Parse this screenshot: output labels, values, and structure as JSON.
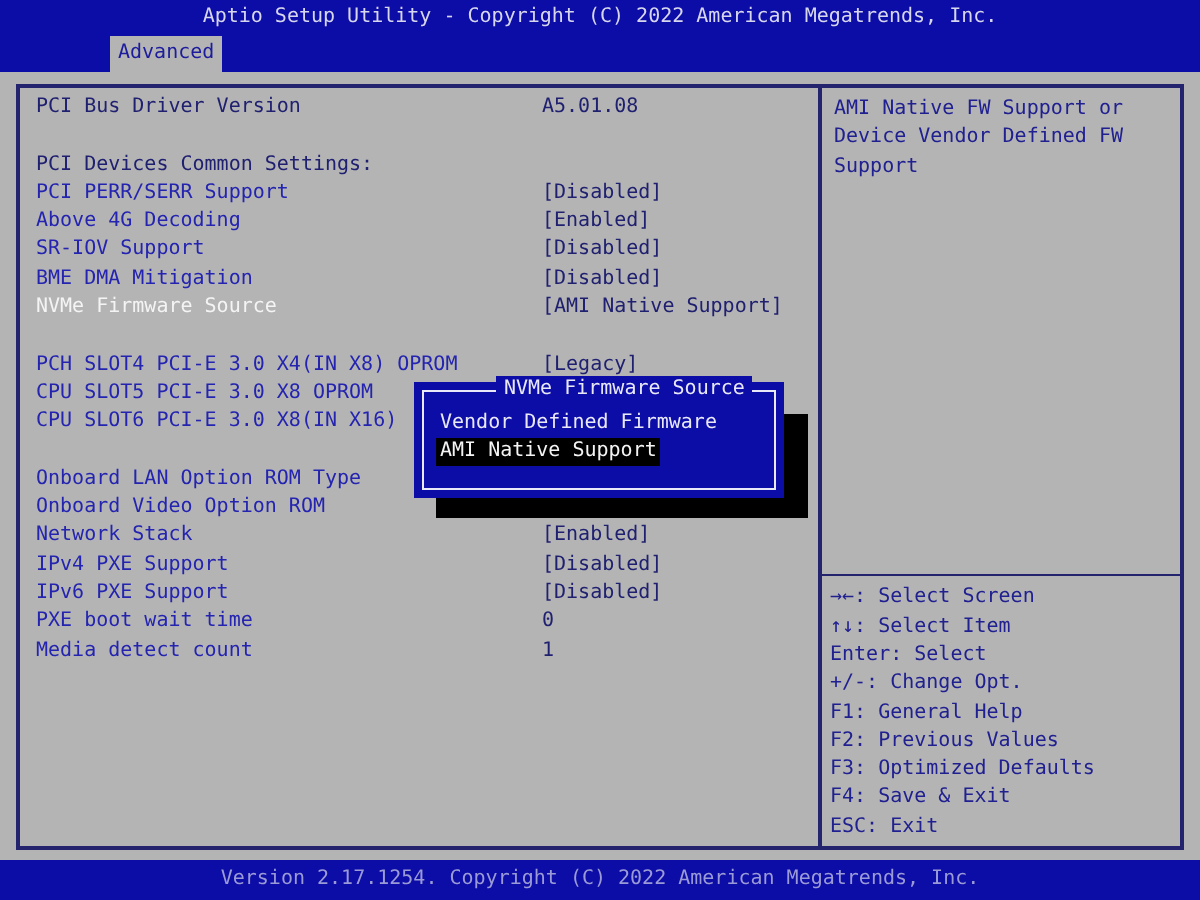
{
  "window": {
    "title": "Aptio Setup Utility - Copyright (C) 2022 American Megatrends, Inc."
  },
  "tabs": [
    {
      "label": "Advanced",
      "selected": true
    }
  ],
  "settings": [
    {
      "rows": [
        {
          "kind": "info",
          "label": "PCI Bus Driver Version",
          "value": "A5.01.08",
          "selected": false
        }
      ]
    },
    {
      "rows": [
        {
          "kind": "info",
          "label": "PCI Devices Common Settings:",
          "selected": false
        },
        {
          "kind": "option",
          "label": "PCI PERR/SERR Support",
          "value": "[Disabled]",
          "selected": false
        },
        {
          "kind": "option",
          "label": "Above 4G Decoding",
          "value": "[Enabled]",
          "selected": false
        },
        {
          "kind": "option",
          "label": "SR-IOV Support",
          "value": "[Disabled]",
          "selected": false
        },
        {
          "kind": "option",
          "label": "BME DMA Mitigation",
          "value": "[Disabled]",
          "selected": false
        },
        {
          "kind": "option",
          "label": "NVMe Firmware Source",
          "value": "[AMI Native Support]",
          "selected": true
        }
      ]
    },
    {
      "rows": [
        {
          "kind": "option",
          "label": "PCH SLOT4 PCI-E 3.0 X4(IN X8) OPROM",
          "value": "[Legacy]",
          "selected": false
        },
        {
          "kind": "option",
          "label": "CPU SLOT5 PCI-E 3.0 X8 OPROM",
          "selected": false
        },
        {
          "kind": "option",
          "label": "CPU SLOT6 PCI-E 3.0 X8(IN X16)",
          "selected": false
        }
      ]
    },
    {
      "rows": [
        {
          "kind": "option",
          "label": "Onboard LAN Option ROM Type",
          "selected": false
        },
        {
          "kind": "option",
          "label": "Onboard Video Option ROM",
          "selected": false
        },
        {
          "kind": "option",
          "label": "Network Stack",
          "value": "[Enabled]",
          "selected": false
        },
        {
          "kind": "option",
          "label": "IPv4 PXE Support",
          "value": "[Disabled]",
          "selected": false
        },
        {
          "kind": "option",
          "label": "IPv6 PXE Support",
          "value": "[Disabled]",
          "selected": false
        },
        {
          "kind": "option",
          "label": "PXE boot wait time",
          "value": "0",
          "selected": false
        },
        {
          "kind": "option",
          "label": "Media detect count",
          "value": "1",
          "selected": false
        }
      ]
    }
  ],
  "popup": {
    "title": "NVMe Firmware Source",
    "options": [
      {
        "label": "Vendor Defined Firmware",
        "selected": false
      },
      {
        "label": "AMI Native Support",
        "selected": true
      }
    ]
  },
  "help_text": "AMI Native FW Support or Device Vendor Defined FW Support",
  "key_help": [
    "→←: Select Screen",
    "↑↓: Select Item",
    "Enter: Select",
    "+/-: Change Opt.",
    "F1: General Help",
    "F2: Previous Values",
    "F3: Optimized Defaults",
    "F4: Save & Exit",
    "ESC: Exit"
  ],
  "status_bar": "Version 2.17.1254. Copyright (C) 2022 American Megatrends, Inc."
}
